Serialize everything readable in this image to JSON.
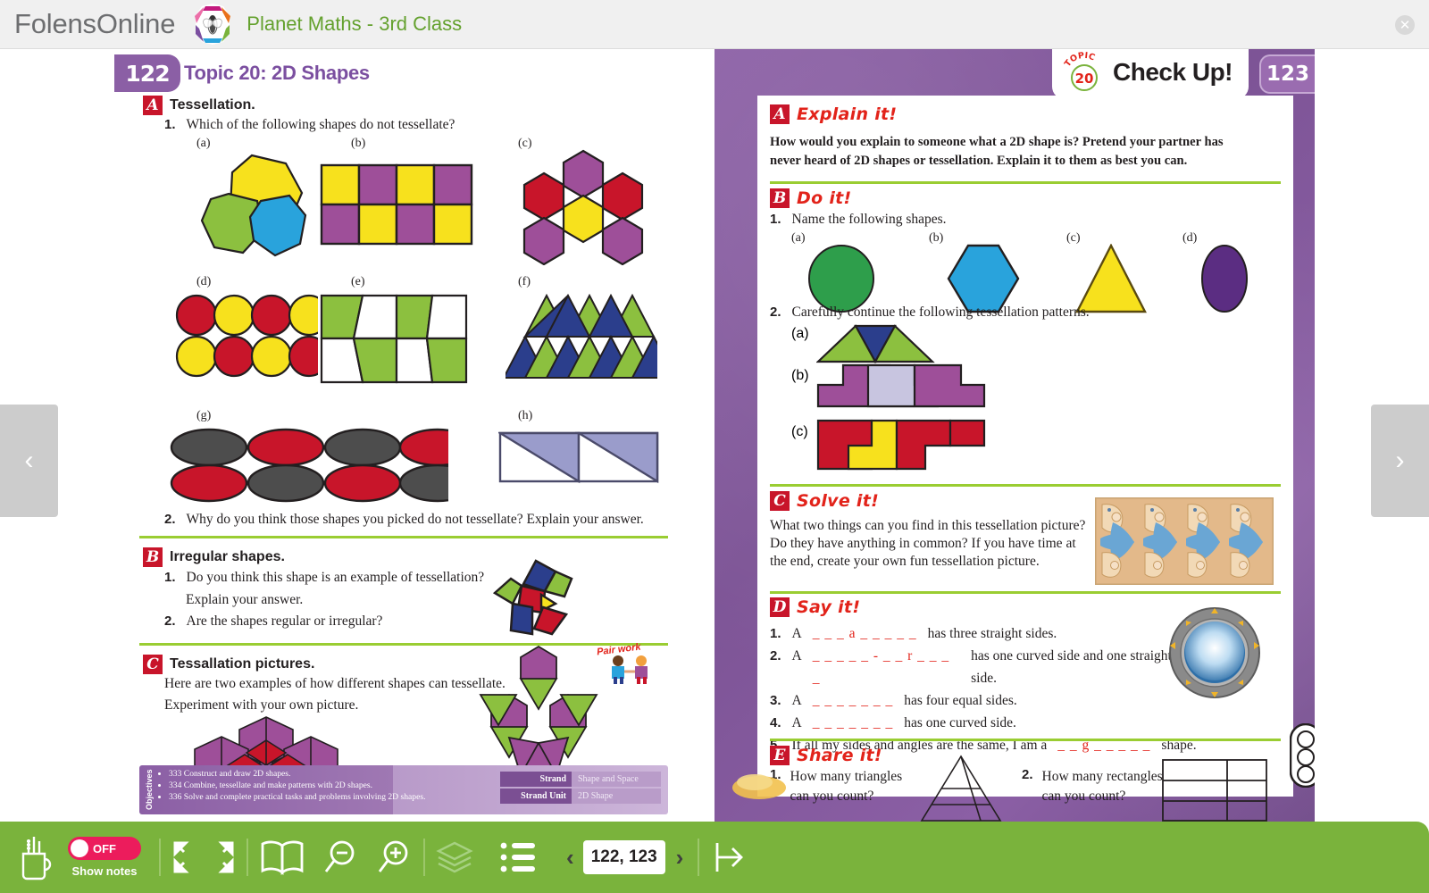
{
  "app": {
    "brand": "FolensOnline",
    "subject": "Planet Maths - 3rd Class",
    "close_icon": "close-icon",
    "logo_icon": "bee-hexagon-logo"
  },
  "viewer": {
    "prev_arrow": "‹",
    "next_arrow": "›",
    "spread_label": "122, 123"
  },
  "left_page": {
    "page_number": "122",
    "topic_title": "Topic 20: 2D Shapes",
    "sections": [
      {
        "badge": "A",
        "title": "Tessellation.",
        "questions": [
          {
            "num": "1.",
            "text": "Which of the following shapes do not tessellate?"
          },
          {
            "num": "2.",
            "text": "Why do you think those shapes you picked do not tessellate? Explain your answer."
          }
        ],
        "shape_labels": [
          "(a)",
          "(b)",
          "(c)",
          "(d)",
          "(e)",
          "(f)",
          "(g)",
          "(h)"
        ]
      },
      {
        "badge": "B",
        "title": "Irregular shapes.",
        "questions": [
          {
            "num": "1.",
            "text": "Do you think this shape is an example of tessellation?"
          },
          {
            "num": "",
            "text": "Explain your answer."
          },
          {
            "num": "2.",
            "text": "Are the shapes regular or irregular?"
          }
        ]
      },
      {
        "badge": "C",
        "title": "Tessallation pictures.",
        "questions": [
          {
            "num": "",
            "text": "Here are two examples of how different shapes can tessellate."
          },
          {
            "num": "",
            "text": "Experiment with your own picture."
          }
        ],
        "pair_work_label": "Pair work"
      }
    ],
    "objectives": {
      "vertical_label": "Objectives",
      "items": [
        "333 Construct and draw 2D shapes.",
        "334 Combine, tessellate and make patterns with 2D shapes.",
        "336 Solve and complete practical tasks and problems involving 2D shapes."
      ],
      "strand_key": "Strand",
      "strand_value": "Shape and Space",
      "strand_unit_key": "Strand Unit",
      "strand_unit_value": "2D Shape"
    }
  },
  "right_page": {
    "page_number": "123",
    "header": {
      "topic_word": "TOPIC",
      "topic_number": "20",
      "title": "Check Up!"
    },
    "sections": [
      {
        "badge": "A",
        "title": "Explain it!",
        "body_lines": [
          "How would you explain to someone what a 2D shape is? Pretend your partner has",
          "never heard of 2D shapes or tessellation. Explain it to them as best you can."
        ]
      },
      {
        "badge": "B",
        "title": "Do it!",
        "q1_num": "1.",
        "q1_text": "Name the following shapes.",
        "q1_labels": [
          "(a)",
          "(b)",
          "(c)",
          "(d)"
        ],
        "q2_num": "2.",
        "q2_text": "Carefully continue the following tessellation patterns.",
        "q2_labels": [
          "(a)",
          "(b)",
          "(c)"
        ]
      },
      {
        "badge": "C",
        "title": "Solve it!",
        "body_lines": [
          "What two things can you find in this tessellation picture?",
          "Do they have anything in common? If you have time at",
          "the end, create your own fun tessellation picture."
        ]
      },
      {
        "badge": "D",
        "title": "Say it!",
        "items": [
          {
            "num": "1.",
            "pre": "A ",
            "blank": "_ _ _ a _ _ _ _ _",
            "post": " has three straight sides."
          },
          {
            "num": "2.",
            "pre": "A ",
            "blank": "_ _ _ _ _ - _ _ r _ _ _ _",
            "post": " has one curved side and one straight side."
          },
          {
            "num": "3.",
            "pre": "A ",
            "blank": "_ _ _ _ _ _ _",
            "post": " has four equal sides."
          },
          {
            "num": "4.",
            "pre": "A ",
            "blank": "_ _ _ _ _ _ _",
            "post": " has one curved side."
          },
          {
            "num": "5.",
            "pre": "If all my sides and angles are the same, I am a ",
            "blank": "_ _ g _ _ _ _ _",
            "post": " shape."
          }
        ]
      },
      {
        "badge": "E",
        "title": "Share it!",
        "items": [
          {
            "num": "1.",
            "line1": "How many triangles",
            "line2": "can you count?"
          },
          {
            "num": "2.",
            "line1": "How many rectangles",
            "line2": "can you count?"
          }
        ]
      }
    ]
  },
  "toolbar": {
    "notes_state": "OFF",
    "notes_label": "Show notes",
    "pencil_cup_icon": "pencil-cup-icon",
    "fullscreen_icon": "fullscreen-icon",
    "exitscreen_icon": "exit-fullscreen-icon",
    "book_icon": "book-spread-icon",
    "zoom_out_icon": "zoom-out-icon",
    "zoom_in_icon": "zoom-in-icon",
    "layers_icon": "layers-icon",
    "contents_icon": "contents-list-icon",
    "exit_icon": "exit-arrow-icon",
    "page_value": "122, 123",
    "prev_page_icon": "chevron-left-icon",
    "next_page_icon": "chevron-right-icon"
  },
  "colors": {
    "brand_green": "#64a12e",
    "toolbar_green": "#7ab33c",
    "purple": "#8b5fa5",
    "red_badge": "#c8152a",
    "rule_green": "#9acd32",
    "pink_toggle": "#ec1c5c"
  }
}
